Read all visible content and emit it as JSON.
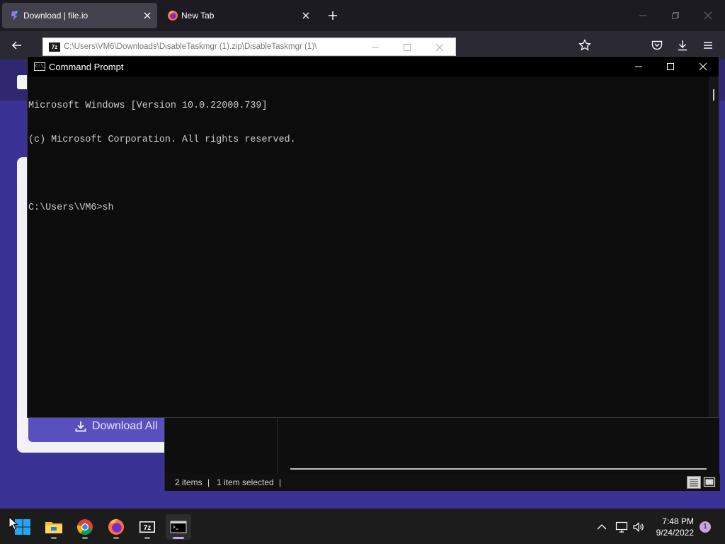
{
  "browser": {
    "tabs": [
      {
        "title": "Download | file.io",
        "favicon": "fileio-favicon-icon",
        "active": true
      },
      {
        "title": "New Tab",
        "favicon": "firefox-favicon-icon",
        "active": false
      }
    ],
    "toolbar_icons": [
      "back-icon",
      "bookmark-star-icon",
      "pocket-icon",
      "downloads-icon",
      "menu-icon"
    ],
    "accent": "#3b3296"
  },
  "page": {
    "download_all_label": "Download All"
  },
  "zip": {
    "title": "C:\\Users\\VM6\\Downloads\\DisableTaskmgr (1).zip\\DisableTaskmgr (1)\\",
    "app_icon_text": "7z",
    "status_items": "2 items",
    "status_selected": "1 item selected",
    "separator": "|"
  },
  "cmd": {
    "title": "Command Prompt",
    "icon_text": "C:\\_",
    "lines": [
      "Microsoft Windows [Version 10.0.22000.739]",
      "(c) Microsoft Corporation. All rights reserved.",
      "",
      "C:\\Users\\VM6>sh"
    ]
  },
  "taskbar": {
    "apps": [
      "start-icon",
      "file-explorer-icon",
      "chrome-icon",
      "firefox-icon",
      "7zip-icon",
      "terminal-icon"
    ],
    "app_7z_label": "7z",
    "time": "7:48 PM",
    "date": "9/24/2022",
    "notification_count": "1"
  }
}
